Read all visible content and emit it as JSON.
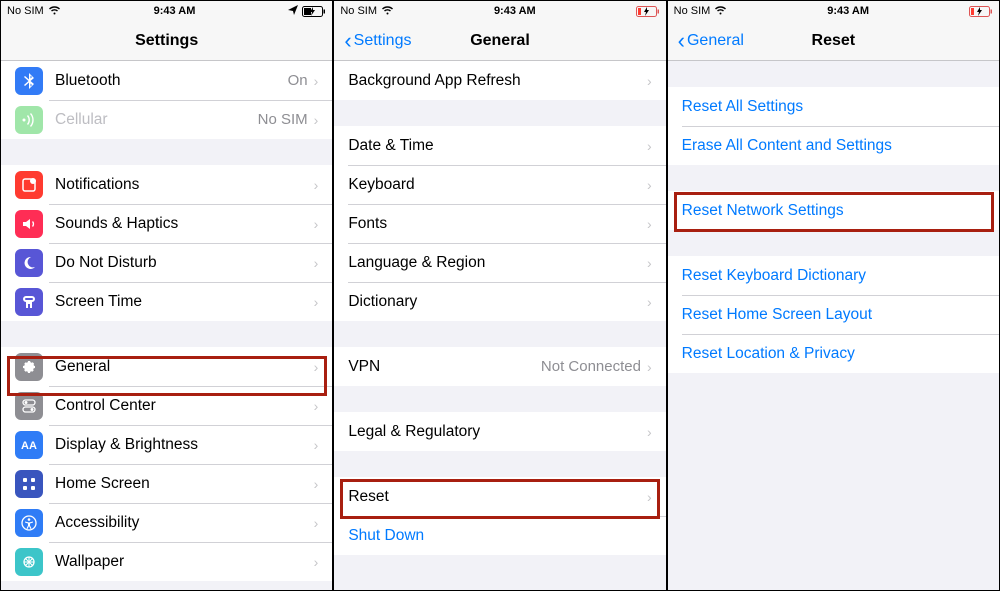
{
  "status": {
    "carrier": "No SIM",
    "time": "9:43 AM"
  },
  "panel1": {
    "title": "Settings",
    "rows": {
      "bluetooth": {
        "label": "Bluetooth",
        "value": "On"
      },
      "cellular": {
        "label": "Cellular",
        "value": "No SIM"
      },
      "notifications": {
        "label": "Notifications"
      },
      "sounds": {
        "label": "Sounds & Haptics"
      },
      "dnd": {
        "label": "Do Not Disturb"
      },
      "screentime": {
        "label": "Screen Time"
      },
      "general": {
        "label": "General"
      },
      "control": {
        "label": "Control Center"
      },
      "display": {
        "label": "Display & Brightness"
      },
      "home": {
        "label": "Home Screen"
      },
      "accessibility": {
        "label": "Accessibility"
      },
      "wallpaper": {
        "label": "Wallpaper"
      }
    }
  },
  "panel2": {
    "back": "Settings",
    "title": "General",
    "rows": {
      "bgapp": {
        "label": "Background App Refresh"
      },
      "datetime": {
        "label": "Date & Time"
      },
      "keyboard": {
        "label": "Keyboard"
      },
      "fonts": {
        "label": "Fonts"
      },
      "lang": {
        "label": "Language & Region"
      },
      "dict": {
        "label": "Dictionary"
      },
      "vpn": {
        "label": "VPN",
        "value": "Not Connected"
      },
      "legal": {
        "label": "Legal & Regulatory"
      },
      "reset": {
        "label": "Reset"
      },
      "shutdown": {
        "label": "Shut Down"
      }
    }
  },
  "panel3": {
    "back": "General",
    "title": "Reset",
    "rows": {
      "resetall": {
        "label": "Reset All Settings"
      },
      "erase": {
        "label": "Erase All Content and Settings"
      },
      "network": {
        "label": "Reset Network Settings"
      },
      "keyboard": {
        "label": "Reset Keyboard Dictionary"
      },
      "home": {
        "label": "Reset Home Screen Layout"
      },
      "location": {
        "label": "Reset Location & Privacy"
      }
    }
  }
}
